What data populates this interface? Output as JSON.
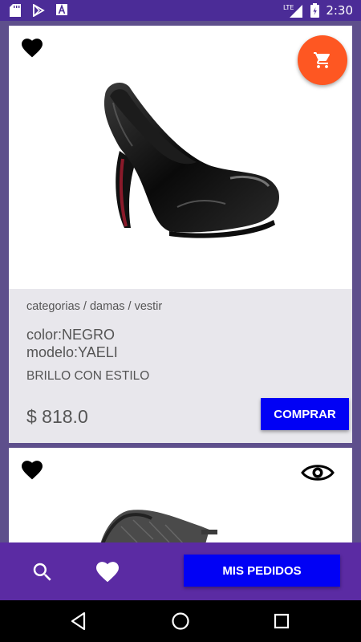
{
  "status_bar": {
    "time": "2:30",
    "network": "LTE",
    "icons": [
      "sd-card-icon",
      "play-store-icon",
      "font-a-icon",
      "signal-icon",
      "battery-icon"
    ]
  },
  "products": [
    {
      "breadcrumb": "categorias / damas / vestir",
      "color": "color:NEGRO",
      "model": "modelo:YAELI",
      "description": "BRILLO CON ESTILO",
      "price": "$ 818.0",
      "buy_label": "COMPRAR",
      "icons": [
        "heart-icon",
        "cart-icon"
      ]
    },
    {
      "icons": [
        "heart-icon",
        "eye-icon"
      ]
    }
  ],
  "bottom_bar": {
    "orders_label": "MIS PEDIDOS",
    "icons": [
      "search-icon",
      "heart-icon"
    ]
  },
  "nav_bar": {
    "icons": [
      "back-icon",
      "home-icon",
      "recents-icon"
    ]
  },
  "colors": {
    "accent": "#fe5722",
    "button_blue": "#0101f5",
    "bottom_bar": "#5b2ba3",
    "status_bar": "#4b2c97"
  }
}
